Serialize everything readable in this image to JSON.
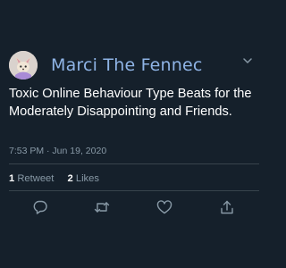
{
  "tweet": {
    "display_name": "Marci The Fennec",
    "text": "Toxic Online Behaviour Type Beats for the Moderately Disappointing and Friends.",
    "timestamp": "7:53 PM · Jun 19, 2020"
  },
  "stats": {
    "retweets_count": "1",
    "retweets_label": "Retweet",
    "likes_count": "2",
    "likes_label": "Likes"
  },
  "icons": {
    "avatar": "fennec-avatar",
    "more": "chevron-down-icon",
    "reply": "reply-icon",
    "retweet": "retweet-icon",
    "like": "heart-icon",
    "share": "share-icon"
  },
  "colors": {
    "background": "#15202b",
    "name": "#8fb4e6",
    "secondary": "#8899a6",
    "divider": "#38444d"
  }
}
